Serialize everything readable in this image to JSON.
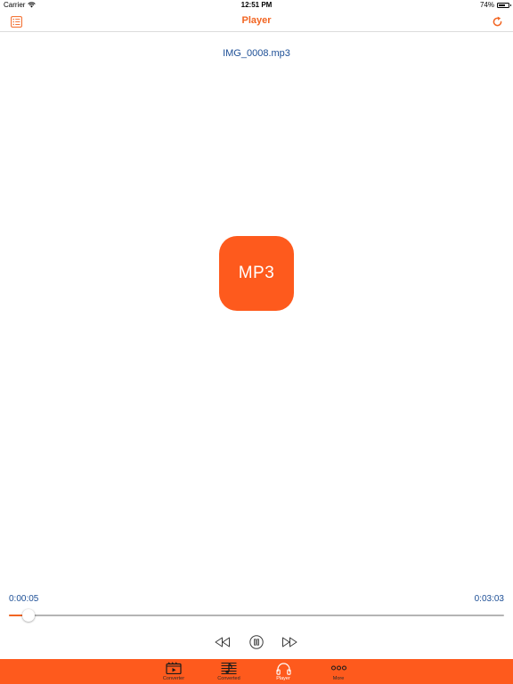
{
  "status_bar": {
    "carrier": "Carrier",
    "time": "12:51 PM",
    "battery": "74%",
    "battery_level": 0.74
  },
  "nav": {
    "title": "Player",
    "left_icon": "list-icon",
    "right_icon": "refresh-icon"
  },
  "player": {
    "file_name": "IMG_0008.mp3",
    "artwork_label": "MP3",
    "elapsed": "0:00:05",
    "duration": "0:03:03",
    "progress": 0.04,
    "state": "playing"
  },
  "tabs": [
    {
      "label": "Converter",
      "icon": "video-converter-icon",
      "active": false
    },
    {
      "label": "Converted",
      "icon": "music-list-icon",
      "active": false
    },
    {
      "label": "Player",
      "icon": "headphones-icon",
      "active": true
    },
    {
      "label": "More",
      "icon": "more-dots-icon",
      "active": false
    }
  ],
  "colors": {
    "accent": "#f26522",
    "tab_bar": "#fe5a1d",
    "artwork": "#fe5a1d",
    "text_blue": "#1d4f96"
  }
}
